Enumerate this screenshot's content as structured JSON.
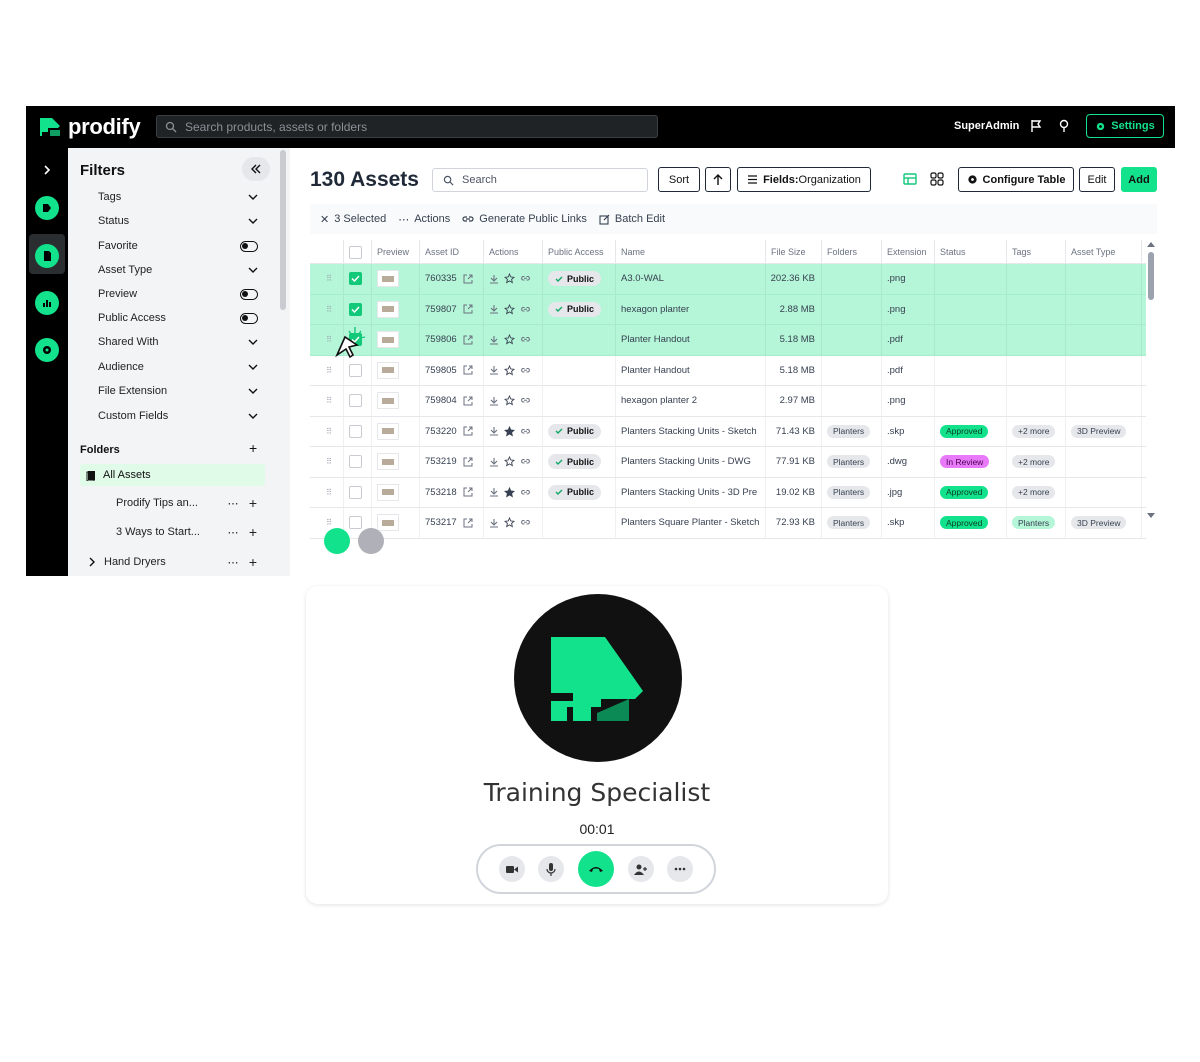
{
  "app": {
    "brand": "prodify",
    "search_placeholder": "Search products, assets or folders",
    "user": "SuperAdmin",
    "settings_label": "Settings"
  },
  "filters": {
    "title": "Filters",
    "items": [
      {
        "label": "Tags",
        "control": "chevron"
      },
      {
        "label": "Status",
        "control": "chevron"
      },
      {
        "label": "Favorite",
        "control": "toggle"
      },
      {
        "label": "Asset Type",
        "control": "chevron"
      },
      {
        "label": "Preview",
        "control": "toggle"
      },
      {
        "label": "Public Access",
        "control": "toggle"
      },
      {
        "label": "Shared With",
        "control": "chevron"
      },
      {
        "label": "Audience",
        "control": "chevron"
      },
      {
        "label": "File Extension",
        "control": "chevron"
      },
      {
        "label": "Custom Fields",
        "control": "chevron"
      }
    ],
    "folders_title": "Folders",
    "all_assets": "All Assets",
    "folders": [
      {
        "name": "Prodify Tips an...",
        "has_chevron": false
      },
      {
        "name": "3 Ways to Start...",
        "has_chevron": false
      },
      {
        "name": "Hand Dryers",
        "has_chevron": true
      }
    ]
  },
  "main": {
    "title": "130 Assets",
    "search_placeholder": "Search",
    "sort_label": "Sort",
    "fields_label": "Fields:",
    "fields_value": "Organization",
    "configure_label": "Configure Table",
    "edit_label": "Edit",
    "add_label": "Add",
    "selection": {
      "count_label": "3 Selected",
      "actions_label": "Actions",
      "links_label": "Generate Public Links",
      "batch_label": "Batch Edit"
    },
    "columns": [
      "Preview",
      "Asset ID",
      "Actions",
      "Public Access",
      "Name",
      "File Size",
      "Folders",
      "Extension",
      "Status",
      "Tags",
      "Asset Type"
    ],
    "rows": [
      {
        "selected": true,
        "id": "760335",
        "star": false,
        "public": "Public",
        "name": "A3.0-WAL",
        "size": "202.36 KB",
        "folder": "",
        "ext": ".png",
        "status": "",
        "tags": "",
        "type": ""
      },
      {
        "selected": true,
        "id": "759807",
        "star": false,
        "public": "Public",
        "name": "hexagon planter",
        "size": "2.88 MB",
        "folder": "",
        "ext": ".png",
        "status": "",
        "tags": "",
        "type": ""
      },
      {
        "selected": true,
        "id": "759806",
        "star": false,
        "public": "",
        "name": "Planter Handout",
        "size": "5.18 MB",
        "folder": "",
        "ext": ".pdf",
        "status": "",
        "tags": "",
        "type": ""
      },
      {
        "selected": false,
        "id": "759805",
        "star": false,
        "public": "",
        "name": "Planter Handout",
        "size": "5.18 MB",
        "folder": "",
        "ext": ".pdf",
        "status": "",
        "tags": "",
        "type": ""
      },
      {
        "selected": false,
        "id": "759804",
        "star": false,
        "public": "",
        "name": "hexagon planter 2",
        "size": "2.97 MB",
        "folder": "",
        "ext": ".png",
        "status": "",
        "tags": "",
        "type": ""
      },
      {
        "selected": false,
        "id": "753220",
        "star": true,
        "public": "Public",
        "name": "Planters Stacking Units - Sketch",
        "size": "71.43 KB",
        "folder": "Planters",
        "ext": ".skp",
        "status": "Approved",
        "tags": "+2 more",
        "type": "3D Preview"
      },
      {
        "selected": false,
        "id": "753219",
        "star": false,
        "public": "Public",
        "name": "Planters Stacking Units - DWG",
        "size": "77.91 KB",
        "folder": "Planters",
        "ext": ".dwg",
        "status": "In Review",
        "tags": "+2 more",
        "type": ""
      },
      {
        "selected": false,
        "id": "753218",
        "star": true,
        "public": "Public",
        "name": "Planters Stacking Units - 3D Pre",
        "size": "19.02 KB",
        "folder": "Planters",
        "ext": ".jpg",
        "status": "Approved",
        "tags": "+2 more",
        "type": ""
      },
      {
        "selected": false,
        "id": "753217",
        "star": false,
        "public": "",
        "name": "Planters Square Planter - Sketch",
        "size": "72.93 KB",
        "folder": "Planters",
        "ext": ".skp",
        "status": "Approved",
        "tags": "Planters",
        "type": "3D Preview"
      }
    ]
  },
  "call": {
    "name": "Training Specialist",
    "timer": "00:01",
    "controls": [
      "video-icon",
      "mic-icon",
      "end-call-icon",
      "add-person-icon",
      "more-icon"
    ]
  },
  "colors": {
    "brand_green": "#12e28b",
    "selected_row": "#b5f6d8",
    "in_review": "#e879f9",
    "dark": "#000000"
  }
}
